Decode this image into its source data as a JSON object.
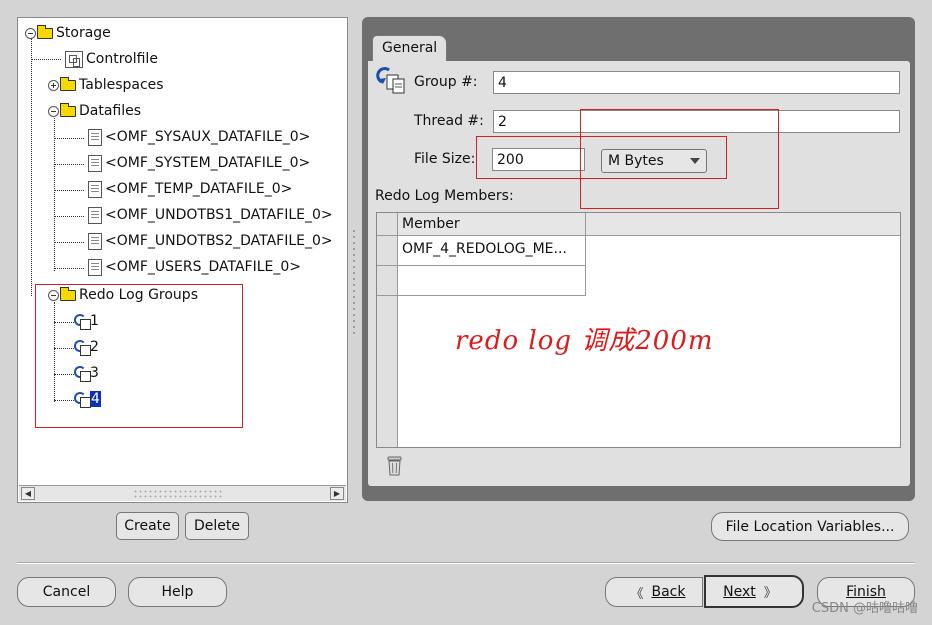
{
  "tree": {
    "root": "Storage",
    "controlfile": "Controlfile",
    "tablespaces": "Tablespaces",
    "datafiles": "Datafiles",
    "datafile_items": [
      "<OMF_SYSAUX_DATAFILE_0>",
      "<OMF_SYSTEM_DATAFILE_0>",
      "<OMF_TEMP_DATAFILE_0>",
      "<OMF_UNDOTBS1_DATAFILE_0>",
      "<OMF_UNDOTBS2_DATAFILE_0>",
      "<OMF_USERS_DATAFILE_0>"
    ],
    "redo_log_groups": "Redo Log Groups",
    "redo_items": [
      "1",
      "2",
      "3",
      "4"
    ],
    "selected": "4"
  },
  "tree_buttons": {
    "create": "Create",
    "delete": "Delete"
  },
  "tab": {
    "general": "General"
  },
  "form": {
    "group_label": "Group #:",
    "group_value": "4",
    "thread_label": "Thread #:",
    "thread_value": "2",
    "filesize_label": "File Size:",
    "filesize_value": "200",
    "unit_selected": "M Bytes",
    "members_label": "Redo Log Members:"
  },
  "members_table": {
    "header": "Member",
    "rows": [
      "OMF_4_REDOLOG_ME...",
      ""
    ]
  },
  "annotation": "redo log 调成200m",
  "buttons": {
    "file_location": "File Location Variables...",
    "cancel": "Cancel",
    "help": "Help",
    "back": "Back",
    "next": "Next",
    "finish": "Finish"
  },
  "watermark": "CSDN @咕噜咕噜",
  "colors": {
    "annotation_red": "#e01919",
    "selection_blue": "#0a2fbf",
    "folder_yellow": "#f7d800"
  }
}
